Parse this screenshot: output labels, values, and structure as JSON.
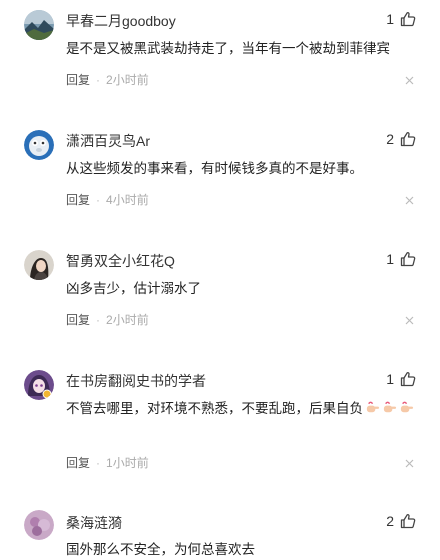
{
  "comments": [
    {
      "username": "早春二月goodboy",
      "likes": "1",
      "text": "是不是又被黑武装劫持走了，当年有一个被劫到菲律宾",
      "reply": "回复",
      "dot": "·",
      "time": "2小时前",
      "avatar": "landscape-avatar"
    },
    {
      "username": "潇洒百灵鸟Ar",
      "likes": "2",
      "text": "从这些频发的事来看，有时候钱多真的不是好事。",
      "reply": "回复",
      "dot": "·",
      "time": "4小时前",
      "avatar": "toy-avatar"
    },
    {
      "username": "智勇双全小红花Q",
      "likes": "1",
      "text": "凶多吉少，估计溺水了",
      "reply": "回复",
      "dot": "·",
      "time": "2小时前",
      "avatar": "girl-avatar"
    },
    {
      "username": "在书房翻阅史书的学者",
      "likes": "1",
      "text": "不管去哪里，对环境不熟悉，不要乱跑，后果自负",
      "reply": "回复",
      "dot": "·",
      "time": "1小时前",
      "avatar": "anime-avatar",
      "emoji": "pointing-hand"
    },
    {
      "username": "桑海涟漪",
      "likes": "2",
      "text": "国外那么不安全，为何总喜欢去",
      "avatar": "flower-avatar"
    }
  ],
  "colors": {
    "text": "#222222",
    "meta": "#aaaaaa",
    "icon": "#444444"
  }
}
